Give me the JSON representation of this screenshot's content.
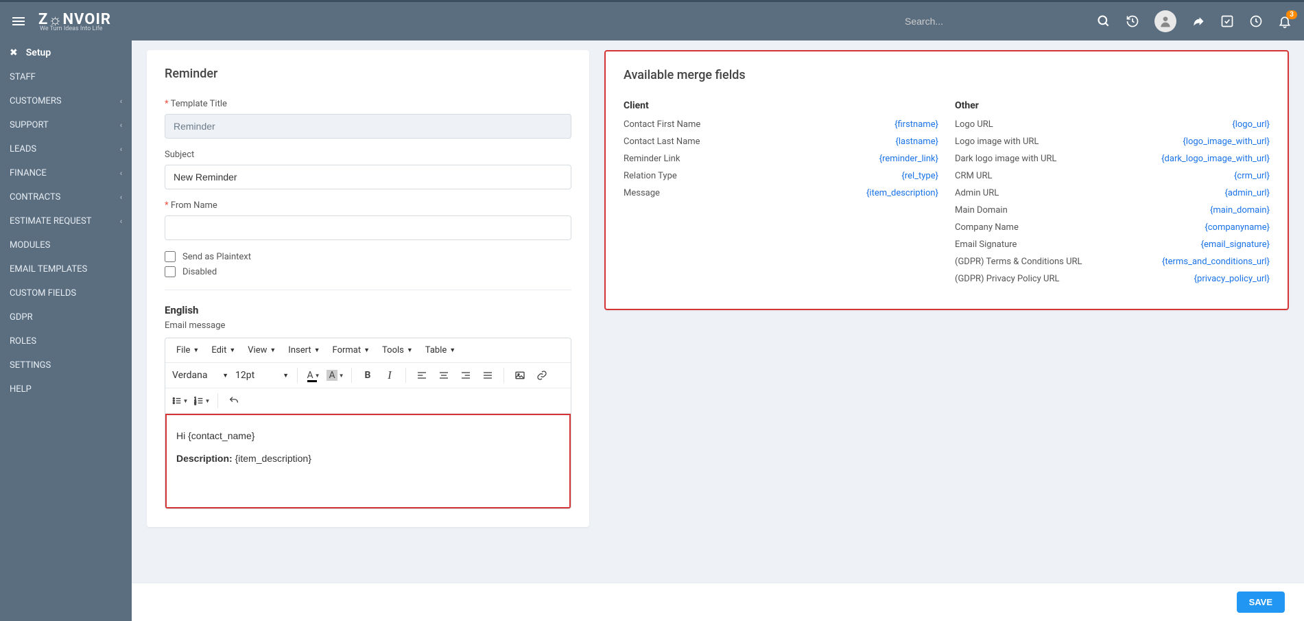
{
  "header": {
    "brand": "ZONVOIR",
    "brand_sub": "We Turn Ideas Into Life",
    "search_placeholder": "Search...",
    "notification_count": "3"
  },
  "sidebar": {
    "setup_label": "Setup",
    "items": [
      {
        "label": "STAFF",
        "expandable": false
      },
      {
        "label": "CUSTOMERS",
        "expandable": true
      },
      {
        "label": "SUPPORT",
        "expandable": true
      },
      {
        "label": "LEADS",
        "expandable": true
      },
      {
        "label": "FINANCE",
        "expandable": true
      },
      {
        "label": "CONTRACTS",
        "expandable": true
      },
      {
        "label": "ESTIMATE REQUEST",
        "expandable": true
      },
      {
        "label": "MODULES",
        "expandable": false
      },
      {
        "label": "EMAIL TEMPLATES",
        "expandable": false
      },
      {
        "label": "CUSTOM FIELDS",
        "expandable": false
      },
      {
        "label": "GDPR",
        "expandable": false
      },
      {
        "label": "ROLES",
        "expandable": false
      },
      {
        "label": "SETTINGS",
        "expandable": false
      },
      {
        "label": "HELP",
        "expandable": false
      }
    ]
  },
  "form": {
    "panel_title": "Reminder",
    "template_title_label": "Template Title",
    "template_title_value": "Reminder",
    "subject_label": "Subject",
    "subject_value": "New Reminder",
    "from_name_label": "From Name",
    "from_name_value": "",
    "send_plaintext_label": "Send as Plaintext",
    "disabled_label": "Disabled",
    "lang_heading": "English",
    "email_message_label": "Email message"
  },
  "editor": {
    "menus": [
      "File",
      "Edit",
      "View",
      "Insert",
      "Format",
      "Tools",
      "Table"
    ],
    "font_family": "Verdana",
    "font_size": "12pt",
    "body_line1": "Hi {contact_name}",
    "body_line2_strong": "Description:",
    "body_line2_rest": " {item_description}"
  },
  "merge": {
    "panel_title": "Available merge fields",
    "client_heading": "Client",
    "other_heading": "Other",
    "client": [
      {
        "name": "Contact First Name",
        "token": "{firstname}"
      },
      {
        "name": "Contact Last Name",
        "token": "{lastname}"
      },
      {
        "name": "Reminder Link",
        "token": "{reminder_link}"
      },
      {
        "name": "Relation Type",
        "token": "{rel_type}"
      },
      {
        "name": "Message",
        "token": "{item_description}"
      }
    ],
    "other": [
      {
        "name": "Logo URL",
        "token": "{logo_url}"
      },
      {
        "name": "Logo image with URL",
        "token": "{logo_image_with_url}"
      },
      {
        "name": "Dark logo image with URL",
        "token": "{dark_logo_image_with_url}"
      },
      {
        "name": "CRM URL",
        "token": "{crm_url}"
      },
      {
        "name": "Admin URL",
        "token": "{admin_url}"
      },
      {
        "name": "Main Domain",
        "token": "{main_domain}"
      },
      {
        "name": "Company Name",
        "token": "{companyname}"
      },
      {
        "name": "Email Signature",
        "token": "{email_signature}"
      },
      {
        "name": "(GDPR) Terms & Conditions URL",
        "token": "{terms_and_conditions_url}"
      },
      {
        "name": "(GDPR) Privacy Policy URL",
        "token": "{privacy_policy_url}"
      }
    ]
  },
  "actions": {
    "save_label": "SAVE"
  }
}
